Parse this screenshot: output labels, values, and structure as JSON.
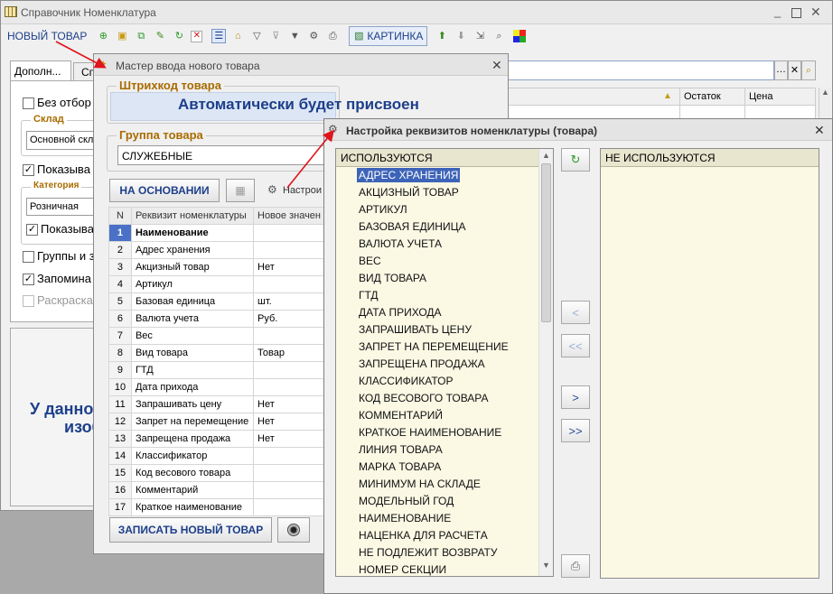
{
  "main_window": {
    "title": "Справочник Номенклатура",
    "new_item_btn": "НОВЫЙ ТОВАР",
    "picture_btn": "КАРТИНКА",
    "tabs": [
      "Дополн...",
      "Сп"
    ],
    "filters": {
      "no_selection": "Без отбор",
      "warehouse_title": "Склад",
      "warehouse_value": "Основной скл",
      "show1": "Показыва",
      "category_title": "Категория",
      "category_value": "Розничная",
      "show2": "Показыва",
      "groups": "Группы и з",
      "remember": "Запомина",
      "coloring": "Раскраска"
    },
    "table_headers": {
      "stock": "Остаток",
      "price": "Цена"
    },
    "side_text_1": "У данно",
    "side_text_2": "изоб"
  },
  "wizard": {
    "title": "Мастер ввода нового товара",
    "barcode_group": "Штрихкод товара",
    "barcode_value": "Автоматически будет присвоен",
    "item_group": "Группа товара",
    "item_group_value": "СЛУЖЕБНЫЕ",
    "based_on_btn": "НА ОСНОВАНИИ",
    "setup_link": "Настрои",
    "columns": {
      "n": "N",
      "attr": "Реквизит номенклатуры",
      "value": "Новое значен"
    },
    "rows": [
      {
        "n": "1",
        "attr": "Наименование",
        "value": ""
      },
      {
        "n": "2",
        "attr": "Адрес хранения",
        "value": ""
      },
      {
        "n": "3",
        "attr": "Акцизный товар",
        "value": "Нет"
      },
      {
        "n": "4",
        "attr": "Артикул",
        "value": ""
      },
      {
        "n": "5",
        "attr": "Базовая единица",
        "value": "шт."
      },
      {
        "n": "6",
        "attr": "Валюта учета",
        "value": "Руб."
      },
      {
        "n": "7",
        "attr": "Вес",
        "value": ""
      },
      {
        "n": "8",
        "attr": "Вид товара",
        "value": "Товар"
      },
      {
        "n": "9",
        "attr": "ГТД",
        "value": ""
      },
      {
        "n": "10",
        "attr": "Дата прихода",
        "value": ""
      },
      {
        "n": "11",
        "attr": "Запрашивать цену",
        "value": "Нет"
      },
      {
        "n": "12",
        "attr": "Запрет на перемещение",
        "value": "Нет"
      },
      {
        "n": "13",
        "attr": "Запрещена продажа",
        "value": "Нет"
      },
      {
        "n": "14",
        "attr": "Классификатор",
        "value": ""
      },
      {
        "n": "15",
        "attr": "Код весового товара",
        "value": ""
      },
      {
        "n": "16",
        "attr": "Комментарий",
        "value": ""
      },
      {
        "n": "17",
        "attr": "Краткое наименование",
        "value": ""
      }
    ],
    "save_btn": "ЗАПИСАТЬ НОВЫЙ ТОВАР"
  },
  "settings": {
    "title": "Настройка реквизитов номенклатуры (товара)",
    "used_header": "ИСПОЛЬЗУЮТСЯ",
    "unused_header": "НЕ ИСПОЛЬЗУЮТСЯ",
    "used_items": [
      "АДРЕС ХРАНЕНИЯ",
      "АКЦИЗНЫЙ ТОВАР",
      "АРТИКУЛ",
      "БАЗОВАЯ ЕДИНИЦА",
      "ВАЛЮТА УЧЕТА",
      "ВЕС",
      "ВИД ТОВАРА",
      "ГТД",
      "ДАТА ПРИХОДА",
      "ЗАПРАШИВАТЬ ЦЕНУ",
      "ЗАПРЕТ НА ПЕРЕМЕЩЕНИЕ",
      "ЗАПРЕЩЕНА ПРОДАЖА",
      "КЛАССИФИКАТОР",
      "КОД ВЕСОВОГО ТОВАРА",
      "КОММЕНТАРИЙ",
      "КРАТКОЕ НАИМЕНОВАНИЕ",
      "ЛИНИЯ ТОВАРА",
      "МАРКА ТОВАРА",
      "МИНИМУМ НА СКЛАДЕ",
      "МОДЕЛЬНЫЙ ГОД",
      "НАИМЕНОВАНИЕ",
      "НАЦЕНКА ДЛЯ РАСЧЕТА",
      "НЕ ПОДЛЕЖИТ ВОЗВРАТУ",
      "НОМЕР СЕКЦИИ"
    ],
    "btn_left": "<",
    "btn_all_left": "<<",
    "btn_right": ">",
    "btn_all_right": ">>"
  },
  "colors": {
    "accent": "#a86b00",
    "selection": "#3d64b8",
    "list_bg": "#fbf8e4",
    "arrow": "#e0141c"
  }
}
